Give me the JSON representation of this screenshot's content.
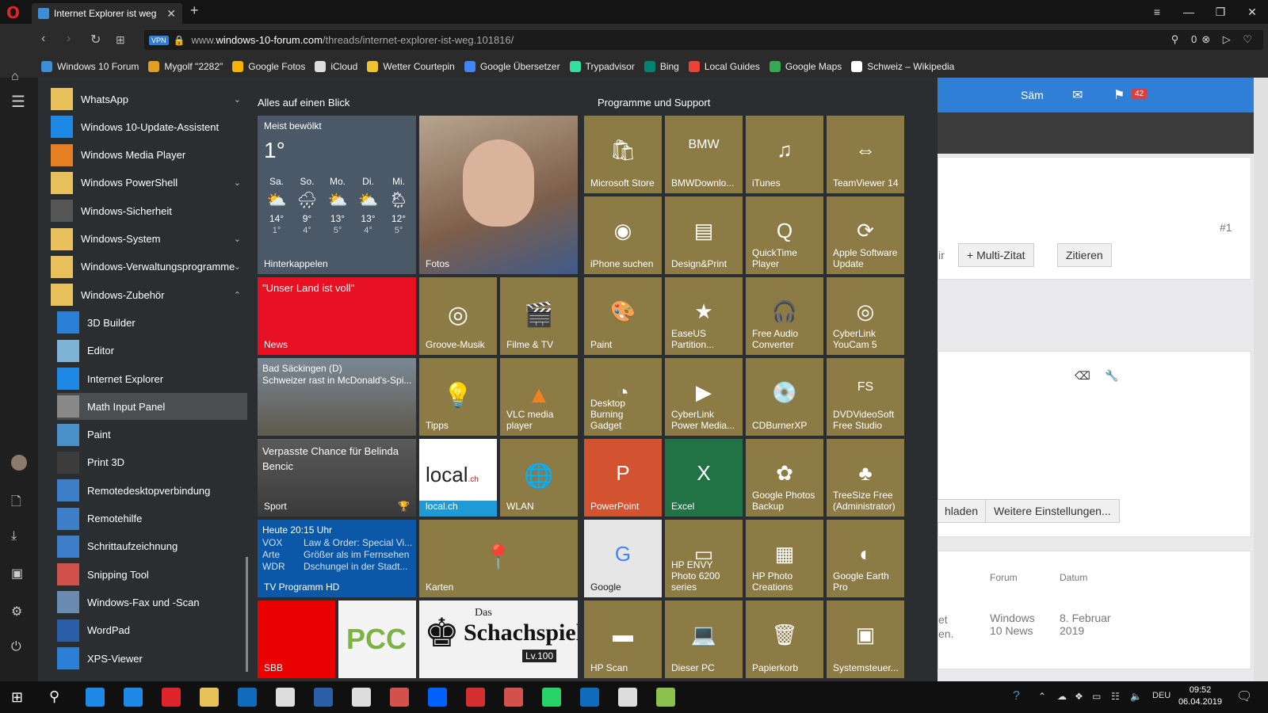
{
  "browser": {
    "tab_title": "Internet Explorer ist weg",
    "url_prefix": "www.",
    "url_domain": "windows-10-forum.com",
    "url_path": "/threads/internet-explorer-ist-weg.101816/",
    "vpn_label": "VPN",
    "url_badge": "0"
  },
  "bookmarks": [
    {
      "label": "Windows 10 Forum",
      "color": "#3c8ed8"
    },
    {
      "label": "Mygolf \"2282\"",
      "color": "#e0a020"
    },
    {
      "label": "Google Fotos",
      "color": "#f4b400"
    },
    {
      "label": "iCloud",
      "color": "#dddddd"
    },
    {
      "label": "Wetter Courtepin",
      "color": "#f2c12e"
    },
    {
      "label": "Google Übersetzer",
      "color": "#4285f4"
    },
    {
      "label": "Trypadvisor",
      "color": "#34e0a1"
    },
    {
      "label": "Bing",
      "color": "#008373"
    },
    {
      "label": "Local Guides",
      "color": "#ea4335"
    },
    {
      "label": "Google Maps",
      "color": "#34a853"
    },
    {
      "label": "Schweiz – Wikipedia",
      "color": "#ffffff"
    }
  ],
  "website": {
    "user": "Säm",
    "notif_count": "42",
    "post_number": "#1",
    "partial_reply": "ir",
    "multi_quote": "+ Multi-Zitat",
    "quote": "Zitieren",
    "upload_partial": "hladen",
    "more_settings": "Weitere Einstellungen...",
    "col_forum": "Forum",
    "col_date": "Datum",
    "row_forum": "Windows 10 News",
    "row_date": "8. Februar 2019",
    "partial1": "et",
    "partial2": "en."
  },
  "start_list": [
    {
      "label": "WhatsApp",
      "color": "#e8c15a",
      "chev": "⌄",
      "sub": false,
      "selected": false
    },
    {
      "label": "Windows 10-Update-Assistent",
      "color": "#1e88e5",
      "chev": "",
      "sub": false,
      "selected": false
    },
    {
      "label": "Windows Media Player",
      "color": "#e67e22",
      "chev": "",
      "sub": false,
      "selected": false
    },
    {
      "label": "Windows PowerShell",
      "color": "#e8c15a",
      "chev": "⌄",
      "sub": false,
      "selected": false
    },
    {
      "label": "Windows-Sicherheit",
      "color": "#555555",
      "chev": "",
      "sub": false,
      "selected": false
    },
    {
      "label": "Windows-System",
      "color": "#e8c15a",
      "chev": "⌄",
      "sub": false,
      "selected": false
    },
    {
      "label": "Windows-Verwaltungsprogramme",
      "color": "#e8c15a",
      "chev": "⌄",
      "sub": false,
      "selected": false
    },
    {
      "label": "Windows-Zubehör",
      "color": "#e8c15a",
      "chev": "⌃",
      "sub": false,
      "selected": false
    },
    {
      "label": "3D Builder",
      "color": "#2c7fd6",
      "chev": "",
      "sub": true,
      "selected": false
    },
    {
      "label": "Editor",
      "color": "#7fb3d5",
      "chev": "",
      "sub": true,
      "selected": false
    },
    {
      "label": "Internet Explorer",
      "color": "#1e88e5",
      "chev": "",
      "sub": true,
      "selected": false
    },
    {
      "label": "Math Input Panel",
      "color": "#888888",
      "chev": "",
      "sub": true,
      "selected": true
    },
    {
      "label": "Paint",
      "color": "#4a90c8",
      "chev": "",
      "sub": true,
      "selected": false
    },
    {
      "label": "Print 3D",
      "color": "#3c3c3c",
      "chev": "",
      "sub": true,
      "selected": false
    },
    {
      "label": "Remotedesktopverbindung",
      "color": "#3c7fc8",
      "chev": "",
      "sub": true,
      "selected": false
    },
    {
      "label": "Remotehilfe",
      "color": "#3c7fc8",
      "chev": "",
      "sub": true,
      "selected": false
    },
    {
      "label": "Schrittaufzeichnung",
      "color": "#3c7fc8",
      "chev": "",
      "sub": true,
      "selected": false
    },
    {
      "label": "Snipping Tool",
      "color": "#d0524a",
      "chev": "",
      "sub": true,
      "selected": false
    },
    {
      "label": "Windows-Fax und -Scan",
      "color": "#6a8ab0",
      "chev": "",
      "sub": true,
      "selected": false
    },
    {
      "label": "WordPad",
      "color": "#2b5fa8",
      "chev": "",
      "sub": true,
      "selected": false
    },
    {
      "label": "XPS-Viewer",
      "color": "#2c7fd6",
      "chev": "",
      "sub": true,
      "selected": false
    }
  ],
  "groups": {
    "left": "Alles auf einen Blick",
    "right": "Programme und Support"
  },
  "weather": {
    "title": "Meist bewölkt",
    "temp": "1°",
    "location": "Hinterkappelen",
    "days": [
      {
        "d": "Sa.",
        "hi": "14°",
        "lo": "1°",
        "icon": "⛅"
      },
      {
        "d": "So.",
        "hi": "9°",
        "lo": "4°",
        "icon": "🌧"
      },
      {
        "d": "Mo.",
        "hi": "13°",
        "lo": "5°",
        "icon": "⛅"
      },
      {
        "d": "Di.",
        "hi": "13°",
        "lo": "4°",
        "icon": "⛅"
      },
      {
        "d": "Mi.",
        "hi": "12°",
        "lo": "5°",
        "icon": "🌦"
      }
    ]
  },
  "tiles_left": {
    "fotos": "Fotos",
    "news_headline": "\"Unser Land ist voll\"",
    "news": "News",
    "groove": "Groove-Musik",
    "filme": "Filme & TV",
    "bad_title": "Bad Säckingen (D)",
    "bad_sub": "Schweizer rast in McDonald's-Spi...",
    "tipps": "Tipps",
    "vlc": "VLC media player",
    "sport_headline": "Verpasste Chance für Belinda Bencic",
    "sport": "Sport",
    "localch_logo": "local",
    "localch_sub": ".ch",
    "localch": "local.ch",
    "wlan": "WLAN",
    "tv_time": "Heute 20:15 Uhr",
    "tv_rows": [
      {
        "ch": "VOX",
        "show": "Law & Order: Special Vi..."
      },
      {
        "ch": "Arte",
        "show": "Größer als im Fernsehen"
      },
      {
        "ch": "WDR",
        "show": "Dschungel in der Stadt..."
      }
    ],
    "tv": "TV Programm HD",
    "karten": "Karten",
    "sbb": "SBB",
    "pcc": "PCC",
    "schach_das": "Das",
    "schach": "Schachspiel",
    "schach_lv": "Lv.100"
  },
  "tiles_right": [
    {
      "label": "Microsoft Store",
      "icon": "🛍",
      "bg": "#8d7b46"
    },
    {
      "label": "BMWDownlo...",
      "icon": "BMW",
      "bg": "#8d7b46"
    },
    {
      "label": "iTunes",
      "icon": "♫",
      "bg": "#8d7b46"
    },
    {
      "label": "TeamViewer 14",
      "icon": "⇔",
      "bg": "#8d7b46"
    },
    {
      "label": "iPhone suchen",
      "icon": "◉",
      "bg": "#8d7b46"
    },
    {
      "label": "Design&Print",
      "icon": "▤",
      "bg": "#8d7b46"
    },
    {
      "label": "QuickTime Player",
      "icon": "Q",
      "bg": "#8d7b46"
    },
    {
      "label": "Apple Software Update",
      "icon": "⟳",
      "bg": "#8d7b46"
    },
    {
      "label": "Paint",
      "icon": "🎨",
      "bg": "#8d7b46"
    },
    {
      "label": "EaseUS Partition...",
      "icon": "★",
      "bg": "#8d7b46"
    },
    {
      "label": "Free Audio Converter",
      "icon": "🎧",
      "bg": "#8d7b46"
    },
    {
      "label": "CyberLink YouCam 5",
      "icon": "◎",
      "bg": "#8d7b46"
    },
    {
      "label": "Desktop Burning Gadget",
      "icon": "◔",
      "bg": "#8d7b46"
    },
    {
      "label": "CyberLink Power Media...",
      "icon": "▶",
      "bg": "#8d7b46"
    },
    {
      "label": "CDBurnerXP",
      "icon": "💿",
      "bg": "#8d7b46"
    },
    {
      "label": "DVDVideoSoft Free Studio",
      "icon": "FS",
      "bg": "#8d7b46"
    },
    {
      "label": "PowerPoint",
      "icon": "P",
      "bg": "#d35230"
    },
    {
      "label": "Excel",
      "icon": "X",
      "bg": "#217346"
    },
    {
      "label": "Google Photos Backup",
      "icon": "✿",
      "bg": "#8d7b46"
    },
    {
      "label": "TreeSize Free (Administrator)",
      "icon": "♣",
      "bg": "#8d7b46"
    },
    {
      "label": "Google",
      "icon": "G",
      "bg": "#e6e6e6"
    },
    {
      "label": "HP ENVY Photo 6200 series",
      "icon": "▭",
      "bg": "#8d7b46"
    },
    {
      "label": "HP Photo Creations",
      "icon": "▦",
      "bg": "#8d7b46"
    },
    {
      "label": "Google Earth Pro",
      "icon": "◐",
      "bg": "#8d7b46"
    },
    {
      "label": "HP Scan",
      "icon": "▬",
      "bg": "#8d7b46"
    },
    {
      "label": "Dieser PC",
      "icon": "💻",
      "bg": "#8d7b46"
    },
    {
      "label": "Papierkorb",
      "icon": "🗑",
      "bg": "#8d7b46"
    },
    {
      "label": "Systemsteuer...",
      "icon": "▣",
      "bg": "#8d7b46"
    }
  ],
  "taskbar": {
    "lang": "DEU",
    "time": "09:52",
    "date": "06.04.2019",
    "apps": [
      "#1e88e5",
      "#1e88e5",
      "#e0242c",
      "#e8c15a",
      "#0f6cbd",
      "#dddddd",
      "#2b5fa8",
      "#dddddd",
      "#d0524a",
      "#0061fe",
      "#d32f2f",
      "#d0524a",
      "#25d366",
      "#0f6cbd",
      "#dddddd",
      "#8ac04b"
    ]
  }
}
